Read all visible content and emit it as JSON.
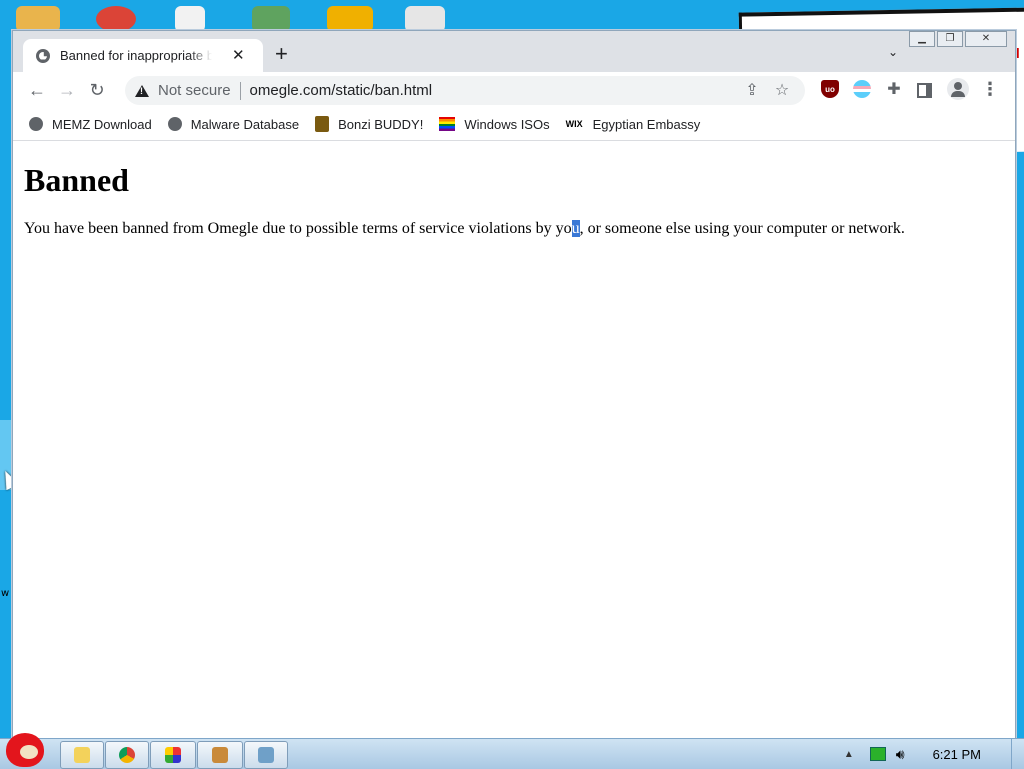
{
  "desktop": {
    "icons": [
      "computer-icon",
      "chrome-icon",
      "solitaire-icon",
      "security-icon",
      "angry-birds-icon",
      "notepad-icon"
    ],
    "stray_letter": "w"
  },
  "browser": {
    "tab": {
      "title": "Banned for inappropriate behavior"
    },
    "omnibox": {
      "security_label": "Not secure",
      "url": "omegle.com/static/ban.html"
    },
    "bookmarks": [
      {
        "label": "MEMZ Download",
        "icon": "globe-icon"
      },
      {
        "label": "Malware Database",
        "icon": "globe-icon"
      },
      {
        "label": "Bonzi BUDDY!",
        "icon": "bonzi-icon"
      },
      {
        "label": "Windows ISOs",
        "icon": "rainbow-flag-icon"
      },
      {
        "label": "Egyptian Embassy",
        "icon": "wix-icon",
        "icon_text": "WIX"
      }
    ],
    "page": {
      "heading": "Banned",
      "text_before": "You have been banned from Omegle due to possible terms of service violations by yo",
      "text_highlight": "u",
      "text_after": ", or someone else using your computer or network."
    }
  },
  "taskbar": {
    "items": [
      "explorer",
      "chrome",
      "paint",
      "app",
      "network-app"
    ],
    "clock": "6:21 PM"
  },
  "colors": {
    "desktop": "#1aa7e6",
    "highlight": "#3a78d6",
    "tabstrip": "#dee1e6"
  }
}
